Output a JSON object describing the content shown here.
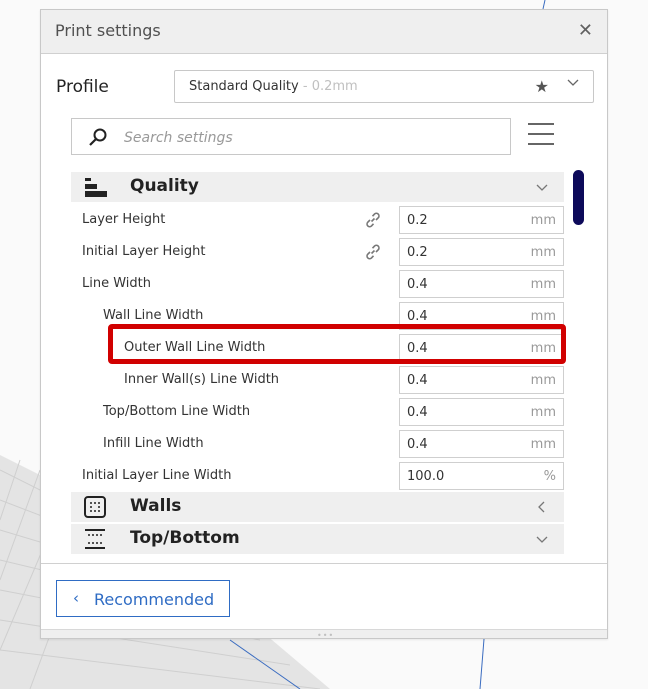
{
  "window": {
    "title": "Print settings",
    "close_icon": "close-icon"
  },
  "profile": {
    "label": "Profile",
    "selected_name": "Standard Quality",
    "selected_sub": " - 0.2mm",
    "star_icon": "star-icon",
    "chevron_icon": "chevron-down-icon"
  },
  "search": {
    "placeholder": "Search settings",
    "value": ""
  },
  "categories": {
    "quality": {
      "label": "Quality",
      "state": "expanded"
    },
    "walls": {
      "label": "Walls",
      "state": "collapsed"
    },
    "top_bottom": {
      "label": "Top/Bottom",
      "state": "expanded"
    }
  },
  "settings": [
    {
      "label": "Layer Height",
      "value": "0.2",
      "unit": "mm",
      "linked": true,
      "indent": 0
    },
    {
      "label": "Initial Layer Height",
      "value": "0.2",
      "unit": "mm",
      "linked": true,
      "indent": 0
    },
    {
      "label": "Line Width",
      "value": "0.4",
      "unit": "mm",
      "linked": false,
      "indent": 0
    },
    {
      "label": "Wall Line Width",
      "value": "0.4",
      "unit": "mm",
      "linked": false,
      "indent": 1
    },
    {
      "label": "Outer Wall Line Width",
      "value": "0.4",
      "unit": "mm",
      "linked": false,
      "indent": 2,
      "highlighted": true
    },
    {
      "label": "Inner Wall(s) Line Width",
      "value": "0.4",
      "unit": "mm",
      "linked": false,
      "indent": 2
    },
    {
      "label": "Top/Bottom Line Width",
      "value": "0.4",
      "unit": "mm",
      "linked": false,
      "indent": 1
    },
    {
      "label": "Infill Line Width",
      "value": "0.4",
      "unit": "mm",
      "linked": false,
      "indent": 1
    },
    {
      "label": "Initial Layer Line Width",
      "value": "100.0",
      "unit": "%",
      "linked": false,
      "indent": 0
    }
  ],
  "footer": {
    "recommended_label": "Recommended",
    "back_icon": "chevron-left-icon"
  },
  "colors": {
    "accent": "#2f6cc4",
    "highlight": "#d10000",
    "scrollbar": "#0d0a5a"
  }
}
